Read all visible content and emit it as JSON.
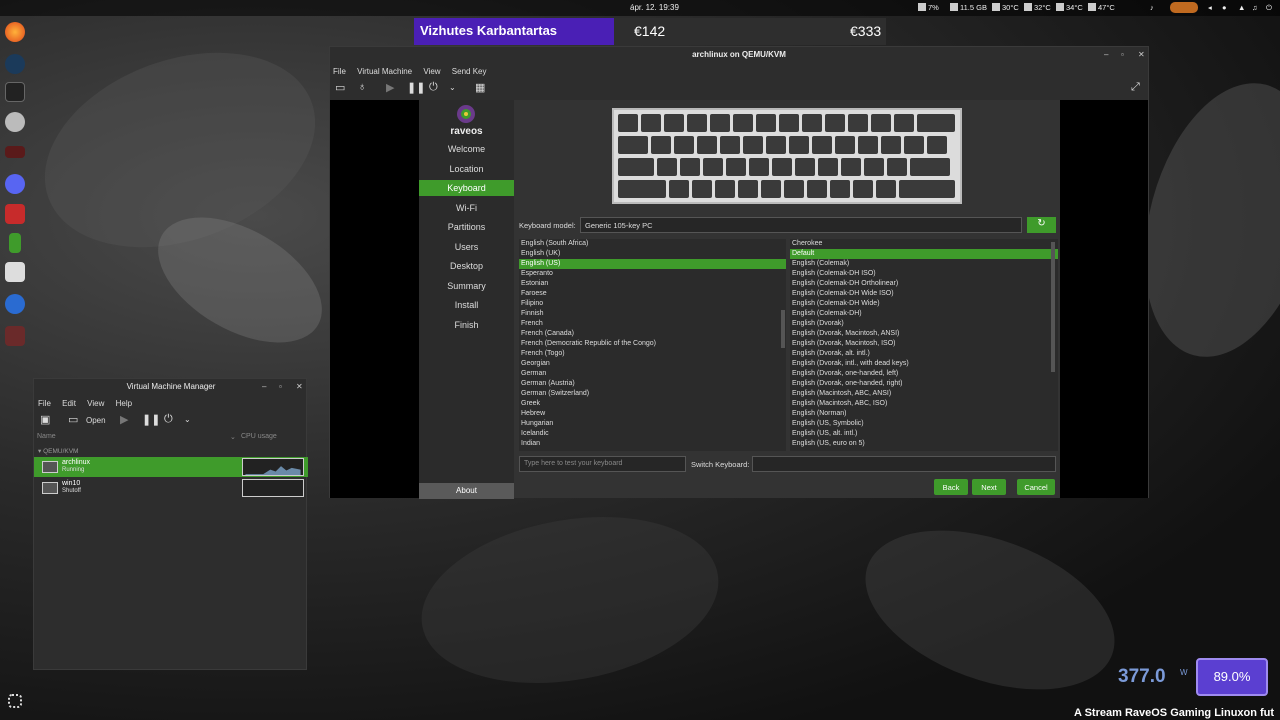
{
  "topbar": {
    "clock": "ápr. 12. 19:39",
    "tray": {
      "battery": "7%",
      "memory": "11.5 GB",
      "temp1": "30°C",
      "temp2": "32°C",
      "temp3": "34°C",
      "temp4": "47°C"
    }
  },
  "banner": {
    "title": "Vizhutes Karbantartas",
    "value1": "€142",
    "value2": "€333"
  },
  "qemu": {
    "title": "archlinux on QEMU/KVM",
    "menu": [
      "File",
      "Virtual Machine",
      "View",
      "Send Key"
    ]
  },
  "installer": {
    "logo": "raveos",
    "steps": [
      "Welcome",
      "Location",
      "Keyboard",
      "Wi-Fi",
      "Partitions",
      "Users",
      "Desktop",
      "Summary",
      "Install",
      "Finish"
    ],
    "active_step": "Keyboard",
    "about": "About",
    "keyboard_model_label": "Keyboard model:",
    "keyboard_model": "Generic 105-key PC",
    "languages": [
      "English (South Africa)",
      "English (UK)",
      "English (US)",
      "Esperanto",
      "Estonian",
      "Faroese",
      "Filipino",
      "Finnish",
      "French",
      "French (Canada)",
      "French (Democratic Republic of the Congo)",
      "French (Togo)",
      "Georgian",
      "German",
      "German (Austria)",
      "German (Switzerland)",
      "Greek",
      "Hebrew",
      "Hungarian",
      "Icelandic",
      "Indian"
    ],
    "selected_language": "English (US)",
    "variants": [
      "Cherokee",
      "Default",
      "English (Colemak)",
      "English (Colemak-DH ISO)",
      "English (Colemak-DH Ortholinear)",
      "English (Colemak-DH Wide ISO)",
      "English (Colemak-DH Wide)",
      "English (Colemak-DH)",
      "English (Dvorak)",
      "English (Dvorak, Macintosh, ANSI)",
      "English (Dvorak, Macintosh, ISO)",
      "English (Dvorak, alt. intl.)",
      "English (Dvorak, intl., with dead keys)",
      "English (Dvorak, one-handed, left)",
      "English (Dvorak, one-handed, right)",
      "English (Macintosh, ABC, ANSI)",
      "English (Macintosh, ABC, ISO)",
      "English (Norman)",
      "English (US, Symbolic)",
      "English (US, alt. intl.)",
      "English (US, euro on 5)"
    ],
    "selected_variant": "Default",
    "test_placeholder": "Type here to test your keyboard",
    "switch_label": "Switch Keyboard:",
    "buttons": {
      "back": "Back",
      "next": "Next",
      "cancel": "Cancel"
    }
  },
  "vmm": {
    "title": "Virtual Machine Manager",
    "menu": [
      "File",
      "Edit",
      "View",
      "Help"
    ],
    "open_label": "Open",
    "col_name": "Name",
    "col_cpu": "CPU usage",
    "group": "QEMU/KVM",
    "vms": [
      {
        "name": "archlinux",
        "status": "Running"
      },
      {
        "name": "win10",
        "status": "Shutoff"
      }
    ]
  },
  "power": {
    "watts": "377.0",
    "unit": "W",
    "percent": "89.0%"
  },
  "ticker": "A Stream RaveOS Gaming Linuxon fut"
}
